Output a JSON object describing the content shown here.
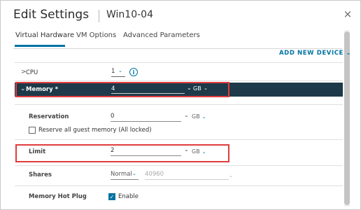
{
  "dialog": {
    "title": "Edit Settings",
    "vm_name": "Win10-04",
    "close_glyph": "×"
  },
  "tabs": [
    {
      "label": "Virtual Hardware",
      "active": true
    },
    {
      "label": "VM Options",
      "active": false
    },
    {
      "label": "Advanced Parameters",
      "active": false
    }
  ],
  "toolbar": {
    "add_device_label": "ADD NEW DEVICE ⌄"
  },
  "cpu": {
    "chevron": ">",
    "label": "CPU",
    "value": "1",
    "info_glyph": "i"
  },
  "memory": {
    "chevron": "⌄",
    "label": "Memory *",
    "value": "4",
    "unit": "GB"
  },
  "reservation": {
    "label": "Reservation",
    "value": "0",
    "unit": "GB"
  },
  "reserve_all": {
    "label": "Reserve all guest memory (All locked)",
    "checked": false
  },
  "limit": {
    "label": "Limit",
    "value": "2",
    "unit": "GB"
  },
  "shares": {
    "label": "Shares",
    "level": "Normal",
    "value": "40960"
  },
  "hot_plug": {
    "label": "Memory Hot Plug",
    "checkbox_label": "Enable",
    "checked": true
  },
  "icons": {
    "spin": "⌄",
    "dropdown": "⌄",
    "check": "✓"
  },
  "colors": {
    "accent": "#0072a3",
    "selected_row": "#1e3949",
    "highlight": "#e03c3c"
  }
}
